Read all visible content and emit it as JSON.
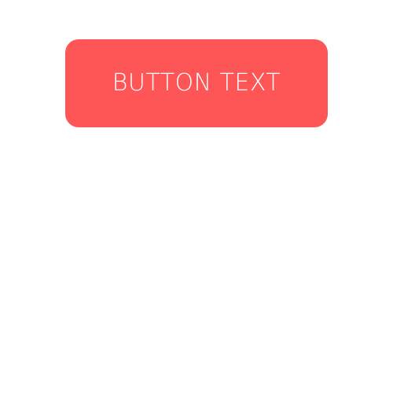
{
  "button": {
    "label": "BUTTON TEXT",
    "background_color": "#fe5656",
    "text_color": "#ffffff"
  },
  "page": {
    "background_color": "#ffffff"
  }
}
